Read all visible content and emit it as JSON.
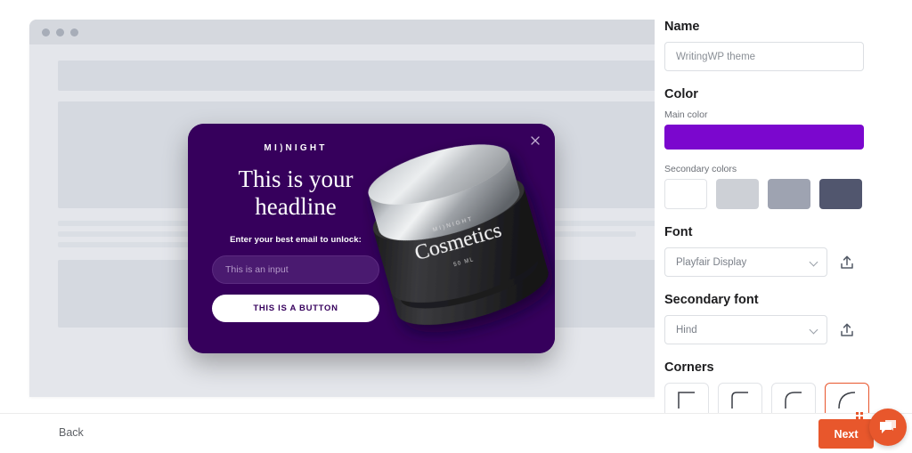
{
  "preview": {
    "browser_dots": [
      "dot-1",
      "dot-2",
      "dot-3"
    ],
    "popup": {
      "brand": "MI)NIGHT",
      "brand_parts": {
        "left": "MI",
        "mark": ")",
        "right": "NIGHT"
      },
      "headline": "This is your headline",
      "subtext": "Enter your best email to unlock:",
      "input_placeholder": "This is an input",
      "button_label": "THIS IS A BUTTON",
      "close_icon": "close-icon",
      "background_color": "#36005c"
    },
    "product": {
      "brand_text": "MI)NIGHT",
      "name_text": "Cosmetics",
      "volume_text": "50 ML"
    }
  },
  "settings": {
    "name": {
      "title": "Name",
      "value": "WritingWP theme",
      "placeholder": "WritingWP theme"
    },
    "color": {
      "title": "Color",
      "main_label": "Main color",
      "main_value": "#7b07ce",
      "secondary_label": "Secondary colors",
      "secondary_values": [
        "#ffffff",
        "#cdd0d6",
        "#9ea3b1",
        "#51566e"
      ]
    },
    "font": {
      "title": "Font",
      "value": "Playfair Display",
      "upload_icon": "upload-icon",
      "chevron_icon": "chevron-down-icon"
    },
    "secondary_font": {
      "title": "Secondary font",
      "value": "Hind",
      "upload_icon": "upload-icon",
      "chevron_icon": "chevron-down-icon"
    },
    "corners": {
      "title": "Corners",
      "options": [
        {
          "label": "None",
          "selected": false
        },
        {
          "label": "Small",
          "selected": false
        },
        {
          "label": "Medium",
          "selected": false
        },
        {
          "label": "Large",
          "selected": true
        }
      ],
      "selected_color": "#e8552c"
    }
  },
  "footer": {
    "back_label": "Back",
    "next_label": "Next",
    "next_color": "#e8572c",
    "chat_icon": "chat-bubble-icon",
    "grip_icon": "drag-grip-icon"
  }
}
